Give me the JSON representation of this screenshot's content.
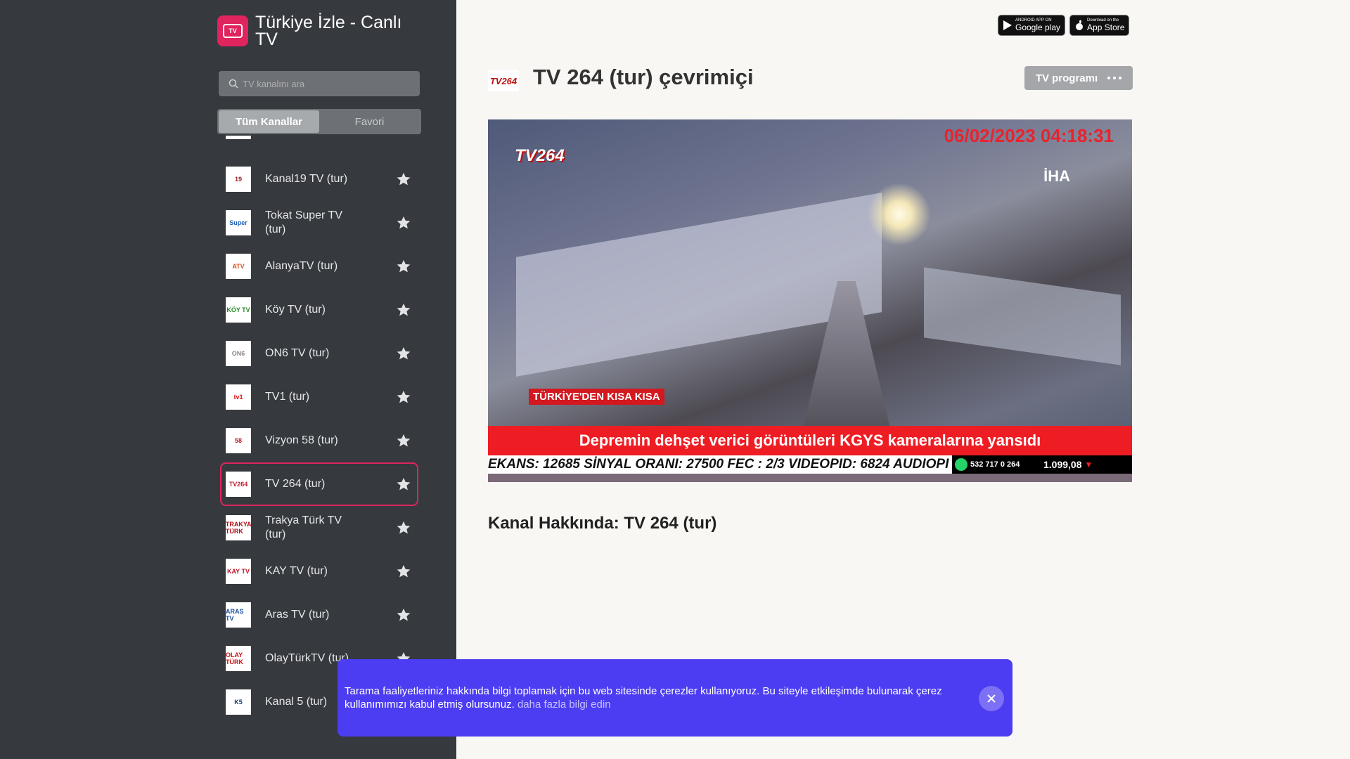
{
  "app": {
    "title": "Türkiye İzle - Canlı TV",
    "logo_text": "TV"
  },
  "search": {
    "placeholder": "TV kanalını ara"
  },
  "tabs": [
    {
      "label": "Tüm Kanallar",
      "active": true
    },
    {
      "label": "Favori",
      "active": false
    }
  ],
  "channels": [
    {
      "name": "Kanal19 TV (tur)",
      "logo": "19",
      "logo_color": "#9b1c1c"
    },
    {
      "name": "Tokat Super TV (tur)",
      "logo": "Super",
      "logo_color": "#1a5fb4"
    },
    {
      "name": "AlanyaTV (tur)",
      "logo": "ATV",
      "logo_color": "#d4541c"
    },
    {
      "name": "Köy TV (tur)",
      "logo": "KÖY TV",
      "logo_color": "#2a8a2a"
    },
    {
      "name": "ON6 TV (tur)",
      "logo": "ON6",
      "logo_color": "#888888"
    },
    {
      "name": "TV1 (tur)",
      "logo": "tv1",
      "logo_color": "#e01010"
    },
    {
      "name": "Vizyon 58 (tur)",
      "logo": "58",
      "logo_color": "#c0182a"
    },
    {
      "name": "TV 264 (tur)",
      "logo": "TV264",
      "logo_color": "#c0182a",
      "active": true
    },
    {
      "name": "Trakya Türk TV (tur)",
      "logo": "TRAKYA TÜRK",
      "logo_color": "#b0101a"
    },
    {
      "name": "KAY TV (tur)",
      "logo": "KAY TV",
      "logo_color": "#c0182a"
    },
    {
      "name": "Aras TV (tur)",
      "logo": "ARAS TV",
      "logo_color": "#1a4fa0"
    },
    {
      "name": "OlayTürkTV (tur)",
      "logo": "OLAY TÜRK",
      "logo_color": "#d01010"
    },
    {
      "name": "Kanal 5 (tur)",
      "logo": "K5",
      "logo_color": "#1a3a70"
    }
  ],
  "store_badges": {
    "google": {
      "small": "ANDROID APP ON",
      "big": "Google play"
    },
    "apple": {
      "small": "Download on the",
      "big": "App Store"
    }
  },
  "page": {
    "channel_logo": "TV264",
    "title": "TV 264 (tur) çevrimiçi",
    "program_button": "TV programı",
    "about_title": "Kanal Hakkında: TV 264 (tur)"
  },
  "video": {
    "date": "06/02/2023 04:18:31",
    "channel_bug": "TV264",
    "agency": "İHA",
    "segment": "TÜRKİYE'DEN KISA KISA",
    "headline": "Depremin dehşet verici görüntüleri KGYS kameralarına yansıdı",
    "ticker": "EKANS: 12685 SİNYAL ORANI: 27500 FEC : 2/3 VIDEOPID: 6824 AUDIOPI",
    "phone": "532 717 0 264",
    "rate": "1.099,08"
  },
  "cookie": {
    "text": "Tarama faaliyetleriniz hakkında bilgi toplamak için bu web sitesinde çerezler kullanıyoruz. Bu siteyle etkileşimde bulunarak çerez kullanımımızı kabul etmiş olursunuz.",
    "link": "daha fazla bilgi edin"
  },
  "colors": {
    "sidebar_bg": "#36393e",
    "accent": "#e0245e",
    "cookie_bg": "#4c3df2",
    "page_bg": "#f8f7f4"
  }
}
